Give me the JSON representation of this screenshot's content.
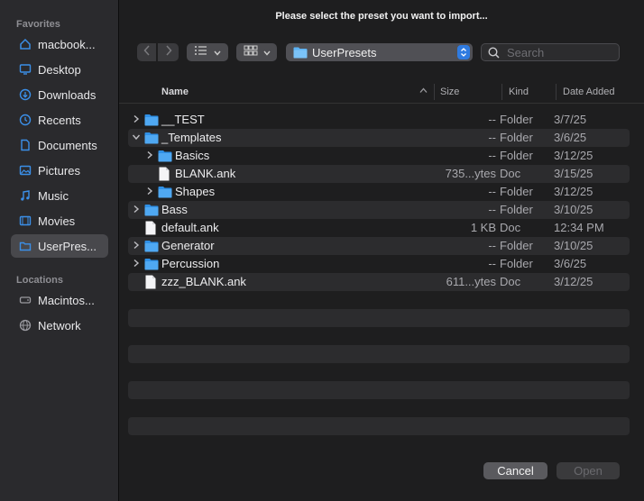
{
  "dialog": {
    "title": "Please select the preset you want to import..."
  },
  "sidebar": {
    "favorites_header": "Favorites",
    "locations_header": "Locations",
    "favorites": [
      {
        "label": "macbook...",
        "icon": "home-icon"
      },
      {
        "label": "Desktop",
        "icon": "desktop-icon"
      },
      {
        "label": "Downloads",
        "icon": "downloads-icon"
      },
      {
        "label": "Recents",
        "icon": "clock-icon"
      },
      {
        "label": "Documents",
        "icon": "document-icon"
      },
      {
        "label": "Pictures",
        "icon": "pictures-icon"
      },
      {
        "label": "Music",
        "icon": "music-note-icon"
      },
      {
        "label": "Movies",
        "icon": "movies-icon"
      },
      {
        "label": "UserPres...",
        "icon": "folder-icon",
        "selected": true
      }
    ],
    "locations": [
      {
        "label": "Macintos...",
        "icon": "disk-icon"
      },
      {
        "label": "Network",
        "icon": "network-globe-icon"
      }
    ]
  },
  "toolbar": {
    "path": "UserPresets",
    "search_placeholder": "Search"
  },
  "columns": {
    "name": "Name",
    "size": "Size",
    "kind": "Kind",
    "date": "Date Added"
  },
  "files": [
    {
      "name": "__TEST",
      "size": "--",
      "kind": "Folder",
      "date": "3/7/25",
      "type": "folder",
      "level": 0,
      "expander": "collapsed"
    },
    {
      "name": "_Templates",
      "size": "--",
      "kind": "Folder",
      "date": "3/6/25",
      "type": "folder",
      "level": 0,
      "expander": "expanded"
    },
    {
      "name": "Basics",
      "size": "--",
      "kind": "Folder",
      "date": "3/12/25",
      "type": "folder",
      "level": 1,
      "expander": "collapsed"
    },
    {
      "name": "BLANK.ank",
      "size": "735...ytes",
      "kind": "Doc",
      "date": "3/15/25",
      "type": "doc",
      "level": 1,
      "expander": "none"
    },
    {
      "name": "Shapes",
      "size": "--",
      "kind": "Folder",
      "date": "3/12/25",
      "type": "folder",
      "level": 1,
      "expander": "collapsed"
    },
    {
      "name": "Bass",
      "size": "--",
      "kind": "Folder",
      "date": "3/10/25",
      "type": "folder",
      "level": 0,
      "expander": "collapsed"
    },
    {
      "name": "default.ank",
      "size": "1 KB",
      "kind": "Doc",
      "date": "12:34 PM",
      "type": "doc",
      "level": 0,
      "expander": "none"
    },
    {
      "name": "Generator",
      "size": "--",
      "kind": "Folder",
      "date": "3/10/25",
      "type": "folder",
      "level": 0,
      "expander": "collapsed"
    },
    {
      "name": "Percussion",
      "size": "--",
      "kind": "Folder",
      "date": "3/6/25",
      "type": "folder",
      "level": 0,
      "expander": "collapsed"
    },
    {
      "name": "zzz_BLANK.ank",
      "size": "611...ytes",
      "kind": "Doc",
      "date": "3/12/25",
      "type": "doc",
      "level": 0,
      "expander": "none"
    }
  ],
  "buttons": {
    "cancel": "Cancel",
    "open": "Open"
  }
}
